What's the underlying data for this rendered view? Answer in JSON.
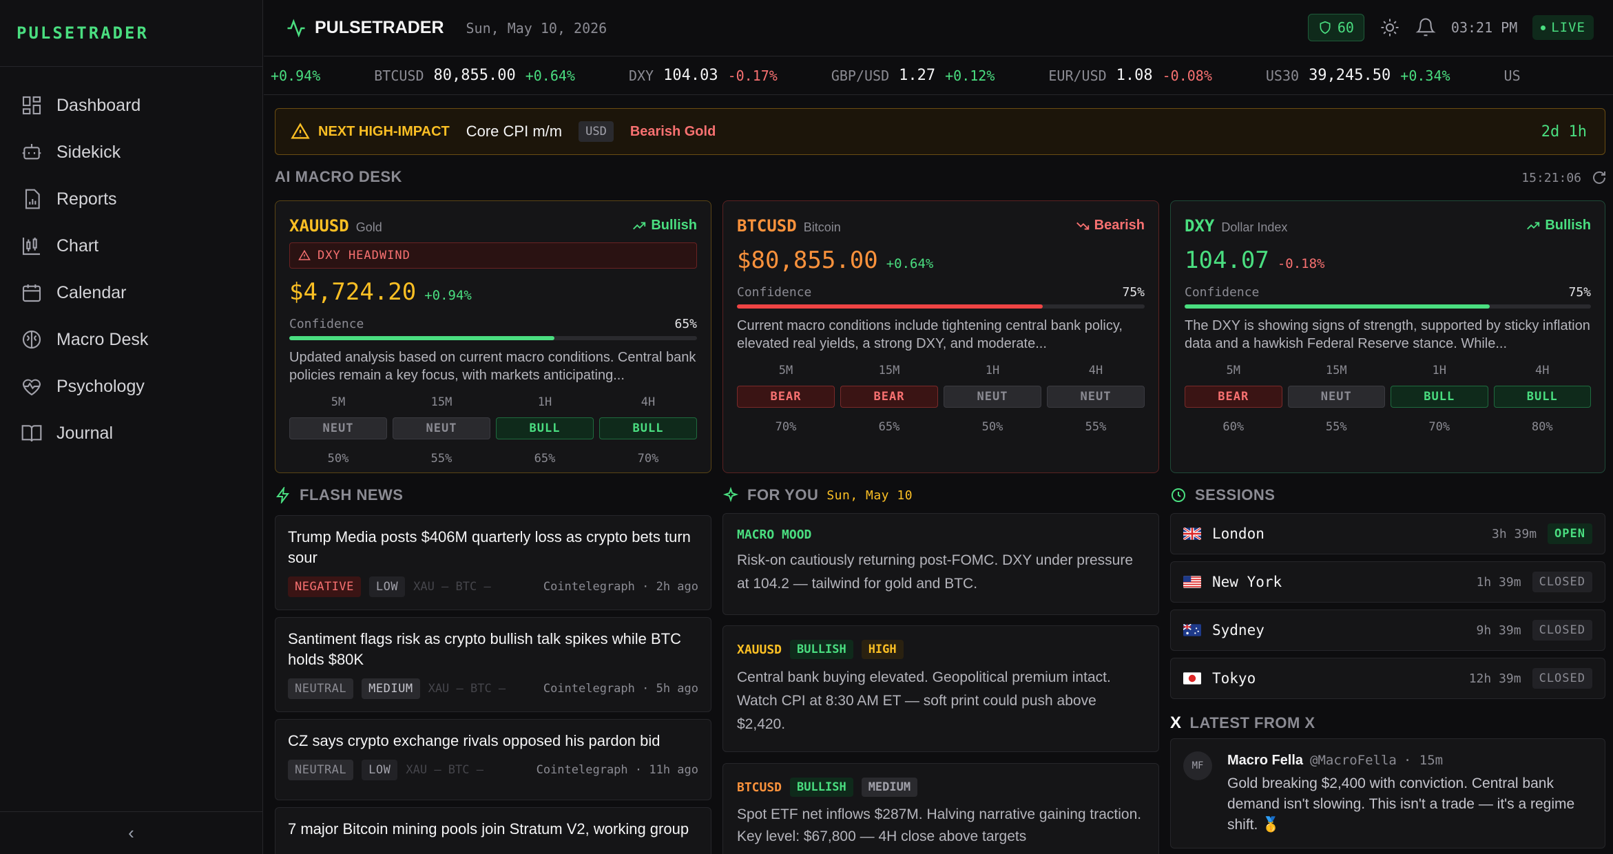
{
  "app": {
    "logo": "PULSETRADER",
    "brand": "PULSETRADER",
    "date": "Sun, May 10, 2026",
    "shield_score": "60",
    "time": "03:21 PM",
    "live": "LIVE"
  },
  "nav": [
    {
      "label": "Dashboard",
      "icon": "grid-icon"
    },
    {
      "label": "Sidekick",
      "icon": "robot-icon"
    },
    {
      "label": "Reports",
      "icon": "report-icon"
    },
    {
      "label": "Chart",
      "icon": "candlestick-icon"
    },
    {
      "label": "Calendar",
      "icon": "calendar-icon"
    },
    {
      "label": "Macro Desk",
      "icon": "brain-icon"
    },
    {
      "label": "Psychology",
      "icon": "heart-pulse-icon"
    },
    {
      "label": "Journal",
      "icon": "book-icon"
    }
  ],
  "collapse": "‹",
  "ticker": [
    {
      "sym": "",
      "px": "",
      "chg": "+0.94%",
      "dir": "up"
    },
    {
      "sym": "BTCUSD",
      "px": "80,855.00",
      "chg": "+0.64%",
      "dir": "up"
    },
    {
      "sym": "DXY",
      "px": "104.03",
      "chg": "-0.17%",
      "dir": "dn"
    },
    {
      "sym": "GBP/USD",
      "px": "1.27",
      "chg": "+0.12%",
      "dir": "up"
    },
    {
      "sym": "EUR/USD",
      "px": "1.08",
      "chg": "-0.08%",
      "dir": "dn"
    },
    {
      "sym": "US30",
      "px": "39,245.50",
      "chg": "+0.34%",
      "dir": "up"
    },
    {
      "sym": "US",
      "px": "",
      "chg": "",
      "dir": "up"
    }
  ],
  "alert": {
    "label": "NEXT HIGH-IMPACT",
    "event": "Core CPI m/m",
    "currency": "USD",
    "bias": "Bearish Gold",
    "countdown": "2d 1h"
  },
  "macro": {
    "title": "AI MACRO DESK",
    "time": "15:21:06"
  },
  "cards": [
    {
      "sym": "XAUUSD",
      "name": "Gold",
      "bias": "Bullish",
      "warn": "DXY HEADWIND",
      "price": "$4,724.20",
      "chg": "+0.94%",
      "conf_label": "Confidence",
      "conf": "65%",
      "conf_value": 0.65,
      "desc": "Updated analysis based on current macro conditions. Central bank policies remain a key focus, with markets anticipating...",
      "tf": [
        {
          "l": "5M",
          "s": "NEUT",
          "p": "50%"
        },
        {
          "l": "15M",
          "s": "NEUT",
          "p": "55%"
        },
        {
          "l": "1H",
          "s": "BULL",
          "p": "65%"
        },
        {
          "l": "4H",
          "s": "BULL",
          "p": "70%"
        }
      ]
    },
    {
      "sym": "BTCUSD",
      "name": "Bitcoin",
      "bias": "Bearish",
      "price": "$80,855.00",
      "chg": "+0.64%",
      "conf_label": "Confidence",
      "conf": "75%",
      "conf_value": 0.75,
      "desc": "Current macro conditions include tightening central bank policy, elevated real yields, a strong DXY, and moderate...",
      "tf": [
        {
          "l": "5M",
          "s": "BEAR",
          "p": "70%"
        },
        {
          "l": "15M",
          "s": "BEAR",
          "p": "65%"
        },
        {
          "l": "1H",
          "s": "NEUT",
          "p": "50%"
        },
        {
          "l": "4H",
          "s": "NEUT",
          "p": "55%"
        }
      ]
    },
    {
      "sym": "DXY",
      "name": "Dollar Index",
      "bias": "Bullish",
      "price": "104.07",
      "chg": "-0.18%",
      "conf_label": "Confidence",
      "conf": "75%",
      "conf_value": 0.75,
      "desc": "The DXY is showing signs of strength, supported by sticky inflation data and a hawkish Federal Reserve stance. While...",
      "tf": [
        {
          "l": "5M",
          "s": "BEAR",
          "p": "60%"
        },
        {
          "l": "15M",
          "s": "NEUT",
          "p": "55%"
        },
        {
          "l": "1H",
          "s": "BULL",
          "p": "70%"
        },
        {
          "l": "4H",
          "s": "BULL",
          "p": "80%"
        }
      ]
    }
  ],
  "flash": {
    "title": "FLASH NEWS",
    "items": [
      {
        "t": "Trump Media posts $406M quarterly loss as crypto bets turn sour",
        "sent": "NEGATIVE",
        "imp": "LOW",
        "assets": "XAU — BTC —",
        "src": "Cointelegraph · 2h ago"
      },
      {
        "t": "Santiment flags risk as crypto bullish talk spikes while BTC holds $80K",
        "sent": "NEUTRAL",
        "imp": "MEDIUM",
        "assets": "XAU — BTC —",
        "src": "Cointelegraph · 5h ago"
      },
      {
        "t": "CZ says crypto exchange rivals opposed his pardon bid",
        "sent": "NEUTRAL",
        "imp": "LOW",
        "assets": "XAU — BTC —",
        "src": "Cointelegraph · 11h ago"
      },
      {
        "t": "7 major Bitcoin mining pools join Stratum V2, working group"
      }
    ]
  },
  "foryou": {
    "title": "FOR YOU",
    "date": "Sun, May 10",
    "mood_label": "MACRO MOOD",
    "mood": "Risk-on cautiously returning post-FOMC. DXY under pressure at 104.2 — tailwind for gold and BTC.",
    "items": [
      {
        "sym": "XAUUSD",
        "bias": "BULLISH",
        "imp": "HIGH",
        "text": "Central bank buying elevated. Geopolitical premium intact. Watch CPI at 8:30 AM ET — soft print could push above $2,420."
      },
      {
        "sym": "BTCUSD",
        "bias": "BULLISH",
        "imp": "MEDIUM",
        "text": "Spot ETF net inflows $287M. Halving narrative gaining traction. Key level: $67,800 — 4H close above targets"
      }
    ]
  },
  "sessions": {
    "title": "SESSIONS",
    "items": [
      {
        "name": "London",
        "time": "3h 39m",
        "status": "OPEN"
      },
      {
        "name": "New York",
        "time": "1h 39m",
        "status": "CLOSED"
      },
      {
        "name": "Sydney",
        "time": "9h 39m",
        "status": "CLOSED"
      },
      {
        "name": "Tokyo",
        "time": "12h 39m",
        "status": "CLOSED"
      }
    ]
  },
  "x": {
    "title": "LATEST FROM X",
    "logo": "X",
    "initials": "MF",
    "name": "Macro Fella",
    "handle": "@MacroFella",
    "age": "· 15m",
    "text": "Gold breaking $2,400 with conviction. Central bank demand isn't slowing. This isn't a trade — it's a regime shift. 🥇"
  },
  "colors": {
    "accent": "#4ade80",
    "bear": "#f87171",
    "gold": "#fbbf24"
  }
}
